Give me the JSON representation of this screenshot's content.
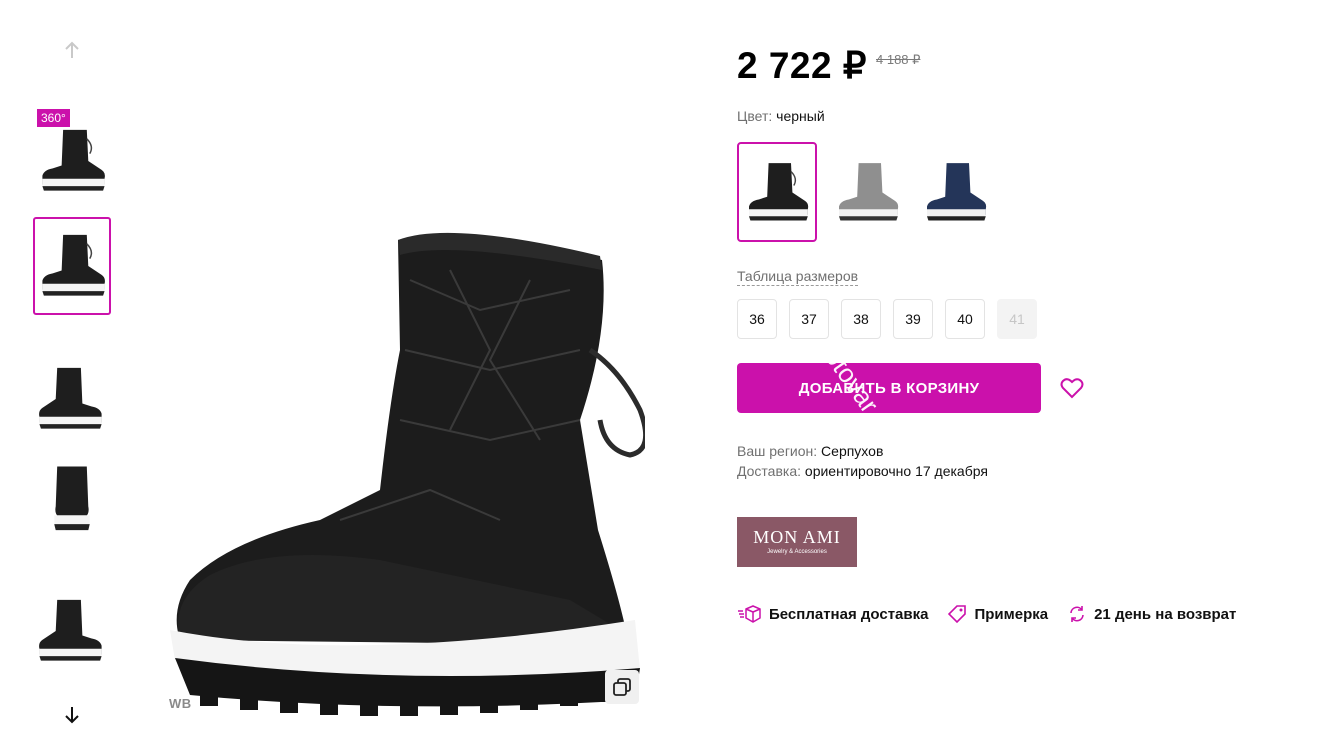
{
  "gallery": {
    "badge_360": "360°",
    "watermark_label": "WB"
  },
  "product": {
    "price": "2 722 ₽",
    "old_price": "4 188 ₽",
    "color_label": "Цвет:",
    "color_value": "черный",
    "swatches": [
      "black",
      "grey",
      "navy"
    ],
    "size_table_label": "Таблица размеров",
    "sizes": [
      {
        "label": "36",
        "available": true
      },
      {
        "label": "37",
        "available": true
      },
      {
        "label": "38",
        "available": true
      },
      {
        "label": "39",
        "available": true
      },
      {
        "label": "40",
        "available": true
      },
      {
        "label": "41",
        "available": false
      }
    ],
    "add_to_cart_label": "ДОБАВИТЬ В КОРЗИНУ",
    "overlay_watermark": "optovar"
  },
  "delivery": {
    "region_label": "Ваш регион:",
    "region_value": "Серпухов",
    "delivery_label": "Доставка:",
    "delivery_value": "ориентировочно 17 декабря"
  },
  "brand": {
    "name": "MON AMI",
    "tagline": "Jewelry & Accessories"
  },
  "features": [
    {
      "icon": "box-icon",
      "label": "Бесплатная доставка"
    },
    {
      "icon": "tag-icon",
      "label": "Примерка"
    },
    {
      "icon": "return-icon",
      "label": "21 день на возврат"
    }
  ],
  "colors": {
    "accent": "#cb11ab",
    "brand_bg": "#8a5866"
  }
}
